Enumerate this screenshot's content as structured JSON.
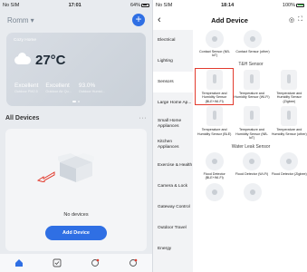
{
  "left": {
    "status": {
      "carrier": "No SIM",
      "time": "17:01",
      "battery": "64%"
    },
    "home_name": "Romm",
    "weather": {
      "location": "Cozy Home",
      "temperature": "27°C",
      "stats": [
        {
          "value": "Excellent",
          "label": "Outdoor PM2.5"
        },
        {
          "value": "Excellent",
          "label": "Outdoor Air Qu..."
        },
        {
          "value": "93.0%",
          "label": "Outdoor Humid..."
        }
      ]
    },
    "devices_title": "All Devices",
    "more": "···",
    "empty_text": "No devices",
    "add_device_label": "Add Device"
  },
  "right": {
    "status": {
      "carrier": "No SIM",
      "time": "18:14",
      "battery": "100%"
    },
    "title": "Add Device",
    "categories": [
      "Electrical",
      "Lighting",
      "Sensors",
      "Large Home Ap...",
      "Small Home Appliances",
      "Kitchen Appliances",
      "Exercise & Health",
      "Camera & Lock",
      "Gateway Control",
      "Outdoor Travel",
      "Energy"
    ],
    "top_row": [
      {
        "label": "Contact Sensor (NB-IoT)"
      },
      {
        "label": "Contact Sensor (other)"
      }
    ],
    "section_th": "T&H Sensor",
    "th_row1": [
      {
        "label": "Temperature and Humidity Sensor (BLE+Wi-Fi)"
      },
      {
        "label": "Temperature and Humidity Sensor (Wi-Fi)"
      },
      {
        "label": "Temperature and Humidity Sensor (Zigbee)"
      }
    ],
    "th_row2": [
      {
        "label": "Temperature and Humidity Sensor (BLE)"
      },
      {
        "label": "Temperature and Humidity Sensor (NB-IoT)"
      },
      {
        "label": "Temperature and Humidity Sensor (other)"
      }
    ],
    "section_wl": "Water Leak Sensor",
    "wl_row": [
      {
        "label": "Flood Detector (BLE+Wi-Fi)"
      },
      {
        "label": "Flood Detector (Wi-Fi)"
      },
      {
        "label": "Flood Detector (Zigbee)"
      }
    ]
  }
}
